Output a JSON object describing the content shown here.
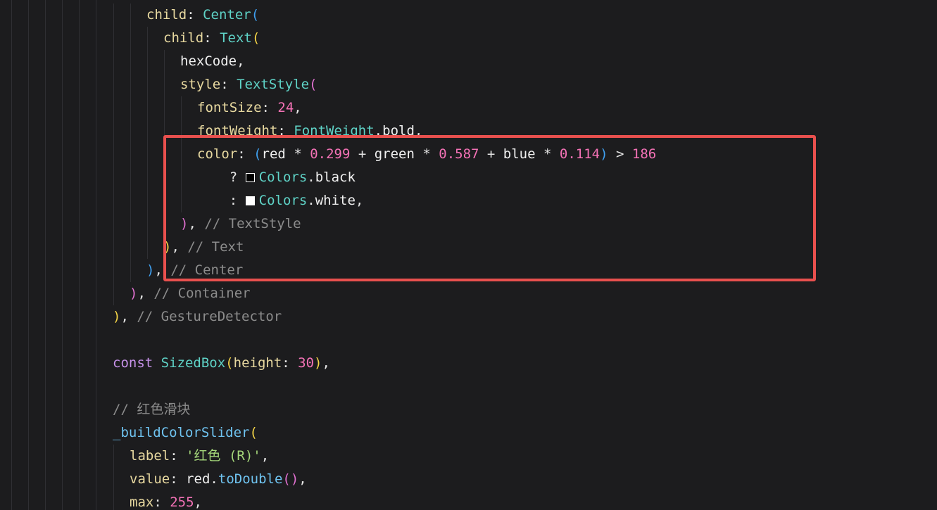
{
  "theme": {
    "background": "#1c1c1e",
    "highlight_color": "#e8504e"
  },
  "palette": {
    "prop": "#e8d9a0",
    "type": "#5fd3c7",
    "punct": "#e6e6e6",
    "num": "#f472b6",
    "comment": "#8c8c8c",
    "kw": "#c792ea",
    "str": "#a5d77a",
    "method": "#6fc3f0",
    "var": "#f0f0f0",
    "bracket_yellow": "#f5d547",
    "bracket_pink": "#e070d0",
    "bracket_blue": "#3fa0f0",
    "op": "#e6e6e6"
  },
  "code_lines": [
    {
      "indent": 4,
      "tokens": [
        {
          "text": "child",
          "c": "prop"
        },
        {
          "text": ": ",
          "c": "punct"
        },
        {
          "text": "Center",
          "c": "type"
        },
        {
          "text": "(",
          "c": "bracket_blue"
        }
      ]
    },
    {
      "indent": 5,
      "tokens": [
        {
          "text": "child",
          "c": "prop"
        },
        {
          "text": ": ",
          "c": "punct"
        },
        {
          "text": "Text",
          "c": "type"
        },
        {
          "text": "(",
          "c": "bracket_yellow"
        }
      ]
    },
    {
      "indent": 6,
      "tokens": [
        {
          "text": "hexCode",
          "c": "var"
        },
        {
          "text": ",",
          "c": "punct"
        }
      ]
    },
    {
      "indent": 6,
      "tokens": [
        {
          "text": "style",
          "c": "prop"
        },
        {
          "text": ": ",
          "c": "punct"
        },
        {
          "text": "TextStyle",
          "c": "type"
        },
        {
          "text": "(",
          "c": "bracket_pink"
        }
      ]
    },
    {
      "indent": 7,
      "tokens": [
        {
          "text": "fontSize",
          "c": "prop"
        },
        {
          "text": ": ",
          "c": "punct"
        },
        {
          "text": "24",
          "c": "num"
        },
        {
          "text": ",",
          "c": "punct"
        }
      ]
    },
    {
      "indent": 7,
      "tokens": [
        {
          "text": "fontWeight",
          "c": "prop"
        },
        {
          "text": ": ",
          "c": "punct"
        },
        {
          "text": "FontWeight",
          "c": "type"
        },
        {
          "text": ".",
          "c": "punct"
        },
        {
          "text": "bold",
          "c": "var"
        },
        {
          "text": ",",
          "c": "punct"
        }
      ]
    },
    {
      "indent": 7,
      "tokens": [
        {
          "text": "color",
          "c": "prop"
        },
        {
          "text": ": ",
          "c": "punct"
        },
        {
          "text": "(",
          "c": "bracket_blue"
        },
        {
          "text": "red",
          "c": "var"
        },
        {
          "text": " * ",
          "c": "op"
        },
        {
          "text": "0.299",
          "c": "num"
        },
        {
          "text": " + ",
          "c": "op"
        },
        {
          "text": "green",
          "c": "var"
        },
        {
          "text": " * ",
          "c": "op"
        },
        {
          "text": "0.587",
          "c": "num"
        },
        {
          "text": " + ",
          "c": "op"
        },
        {
          "text": "blue",
          "c": "var"
        },
        {
          "text": " * ",
          "c": "op"
        },
        {
          "text": "0.114",
          "c": "num"
        },
        {
          "text": ")",
          "c": "bracket_blue"
        },
        {
          "text": " > ",
          "c": "op"
        },
        {
          "text": "186",
          "c": "num"
        }
      ]
    },
    {
      "indent": 7,
      "tokens": [
        {
          "text": "    ? ",
          "c": "op"
        },
        {
          "swatch": "#000000"
        },
        {
          "text": "Colors",
          "c": "type"
        },
        {
          "text": ".",
          "c": "punct"
        },
        {
          "text": "black",
          "c": "var"
        }
      ]
    },
    {
      "indent": 7,
      "tokens": [
        {
          "text": "    : ",
          "c": "op"
        },
        {
          "swatch": "#ffffff"
        },
        {
          "text": "Colors",
          "c": "type"
        },
        {
          "text": ".",
          "c": "punct"
        },
        {
          "text": "white",
          "c": "var"
        },
        {
          "text": ",",
          "c": "punct"
        }
      ]
    },
    {
      "indent": 6,
      "tokens": [
        {
          "text": ")",
          "c": "bracket_pink"
        },
        {
          "text": ", ",
          "c": "punct"
        },
        {
          "text": "// TextStyle",
          "c": "comment"
        }
      ]
    },
    {
      "indent": 5,
      "tokens": [
        {
          "text": ")",
          "c": "bracket_yellow"
        },
        {
          "text": ", ",
          "c": "punct"
        },
        {
          "text": "// Text",
          "c": "comment"
        }
      ]
    },
    {
      "indent": 4,
      "tokens": [
        {
          "text": ")",
          "c": "bracket_blue"
        },
        {
          "text": ", ",
          "c": "punct"
        },
        {
          "text": "// Center",
          "c": "comment"
        }
      ]
    },
    {
      "indent": 3,
      "tokens": [
        {
          "text": ")",
          "c": "bracket_pink"
        },
        {
          "text": ", ",
          "c": "punct"
        },
        {
          "text": "// Container",
          "c": "comment"
        }
      ]
    },
    {
      "indent": 2,
      "tokens": [
        {
          "text": ")",
          "c": "bracket_yellow"
        },
        {
          "text": ", ",
          "c": "punct"
        },
        {
          "text": "// GestureDetector",
          "c": "comment"
        }
      ]
    },
    {
      "indent": 2,
      "tokens": []
    },
    {
      "indent": 2,
      "tokens": [
        {
          "text": "const",
          "c": "kw"
        },
        {
          "text": " ",
          "c": "punct"
        },
        {
          "text": "SizedBox",
          "c": "type"
        },
        {
          "text": "(",
          "c": "bracket_yellow"
        },
        {
          "text": "height",
          "c": "prop"
        },
        {
          "text": ": ",
          "c": "punct"
        },
        {
          "text": "30",
          "c": "num"
        },
        {
          "text": ")",
          "c": "bracket_yellow"
        },
        {
          "text": ",",
          "c": "punct"
        }
      ]
    },
    {
      "indent": 2,
      "tokens": []
    },
    {
      "indent": 2,
      "tokens": [
        {
          "text": "// 红色滑块",
          "c": "comment"
        }
      ]
    },
    {
      "indent": 2,
      "tokens": [
        {
          "text": "_buildColorSlider",
          "c": "method"
        },
        {
          "text": "(",
          "c": "bracket_yellow"
        }
      ]
    },
    {
      "indent": 3,
      "tokens": [
        {
          "text": "label",
          "c": "prop"
        },
        {
          "text": ": ",
          "c": "punct"
        },
        {
          "text": "'红色 (R)'",
          "c": "str"
        },
        {
          "text": ",",
          "c": "punct"
        }
      ]
    },
    {
      "indent": 3,
      "tokens": [
        {
          "text": "value",
          "c": "prop"
        },
        {
          "text": ": ",
          "c": "punct"
        },
        {
          "text": "red",
          "c": "var"
        },
        {
          "text": ".",
          "c": "punct"
        },
        {
          "text": "toDouble",
          "c": "method"
        },
        {
          "text": "()",
          "c": "bracket_pink"
        },
        {
          "text": ",",
          "c": "punct"
        }
      ]
    },
    {
      "indent": 3,
      "tokens": [
        {
          "text": "max",
          "c": "prop"
        },
        {
          "text": ": ",
          "c": "punct"
        },
        {
          "text": "255",
          "c": "num"
        },
        {
          "text": ",",
          "c": "punct"
        }
      ]
    }
  ]
}
